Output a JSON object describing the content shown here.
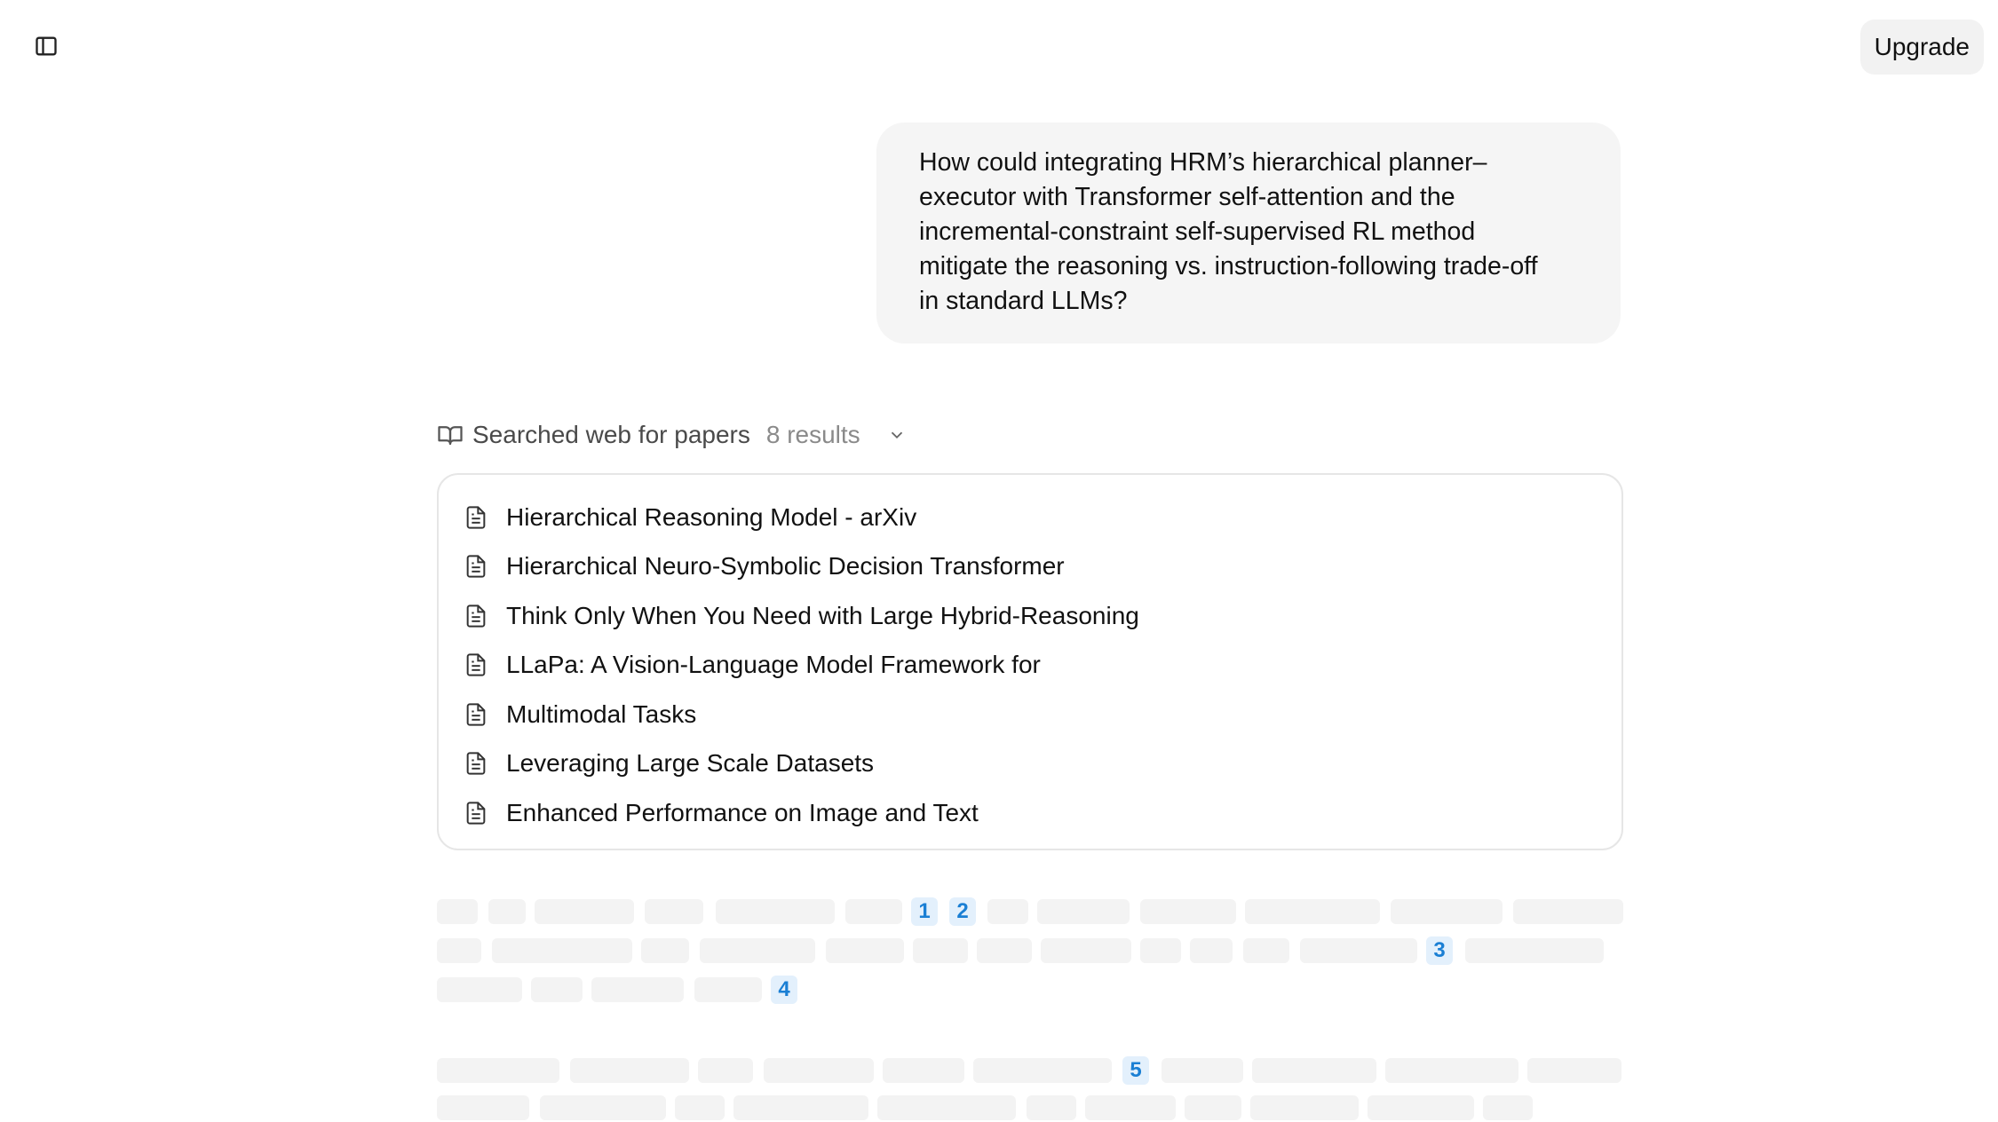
{
  "header": {
    "sidebar_icon": "sidebar-toggle-icon",
    "upgrade_label": "Upgrade"
  },
  "conversation": {
    "user_message": "How could integrating HRM’s hierarchical planner–\nexecutor with Transformer self-attention and the\nincremental-constraint self-supervised RL method\nmitigate the reasoning vs. instruction-following trade-off\nin standard LLMs?"
  },
  "search": {
    "icon": "book-open-icon",
    "label": "Searched web for papers",
    "count": "8 results",
    "chevron": "chevron-down-icon",
    "results": [
      {
        "title": "Hierarchical Reasoning Model - arXiv",
        "icon": "document-icon"
      },
      {
        "title": "Hierarchical Neuro-Symbolic Decision Transformer",
        "icon": "document-icon"
      },
      {
        "title": "Think Only When You Need with Large Hybrid-Reasoning",
        "icon": "document-icon"
      },
      {
        "title": "LLaPa: A Vision-Language Model Framework for",
        "icon": "document-icon"
      },
      {
        "title": "Multimodal Tasks",
        "icon": "document-icon"
      },
      {
        "title": "Leveraging Large Scale Datasets",
        "icon": "document-icon"
      },
      {
        "title": "Enhanced Performance on Image and Text",
        "icon": "document-icon"
      }
    ]
  },
  "citations": [
    "1",
    "2",
    "3",
    "4",
    "5"
  ],
  "colors": {
    "citation_bg": "#e3f0fc",
    "citation_text": "#1a7fd4",
    "skeleton": "#f3f3f3"
  }
}
